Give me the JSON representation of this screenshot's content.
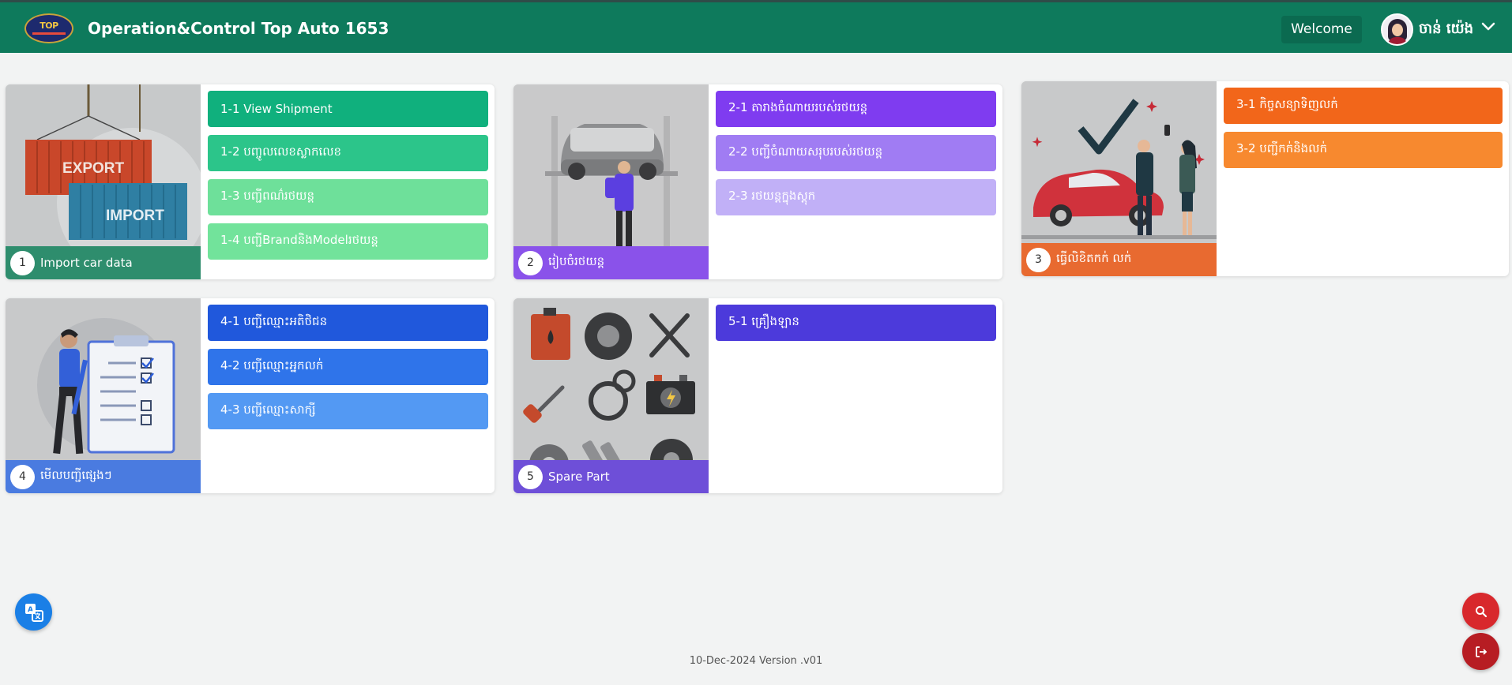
{
  "header": {
    "app_title": "Operation&Control Top Auto 1653",
    "logo_text": "TOP",
    "welcome_label": "Welcome",
    "user_name": "ចាន់ យ៉េង"
  },
  "cards": [
    {
      "number": "1",
      "label": "Import car data",
      "image_icon": "export-import-containers-illustration",
      "caption_color": "#2e8d6d",
      "items": [
        {
          "label": "1-1 View Shipment",
          "color": "#10b07d"
        },
        {
          "label": "1-2 បញ្ចូលលេខស្លាកលេខ",
          "color": "#2cc58a"
        },
        {
          "label": "1-3 បញ្ជីពណ៌រថយន្ត",
          "color": "#6ee09a"
        },
        {
          "label": "1-4 បញ្ជីBrandនិងModelរថយន្ត",
          "color": "#72e39b"
        }
      ]
    },
    {
      "number": "2",
      "label": "រៀបចំរថយន្ត",
      "image_icon": "car-on-lift-mechanic-illustration",
      "caption_color": "#8a52ea",
      "items": [
        {
          "label": "2-1 តារាងចំណាយរបស់រថយន្ត",
          "color": "#7f3cf0"
        },
        {
          "label": "2-2 បញ្ជីចំណាយសរុបរបស់រថយន្ត",
          "color": "#a07cf3"
        },
        {
          "label": "2-3 រថយន្តក្នុងស្តុក",
          "color": "#c1b0f7"
        }
      ]
    },
    {
      "number": "3",
      "label": "ធ្វើលិខិតកក់ លក់",
      "image_icon": "car-sale-handshake-illustration",
      "caption_color": "#e86a30",
      "items": [
        {
          "label": "3-1 កិច្ចសន្យាទិញលក់",
          "color": "#f2661a"
        },
        {
          "label": "3-2 បញ្ជីកក់និងលក់",
          "color": "#f7892f"
        }
      ]
    },
    {
      "number": "4",
      "label": "មើលបញ្ជីផ្សេងៗ",
      "image_icon": "checklist-clipboard-illustration",
      "caption_color": "#4a7be0",
      "items": [
        {
          "label": "4-1 បញ្ជីឈ្មោះអតិថិជន",
          "color": "#2058dc"
        },
        {
          "label": "4-2 បញ្ជីឈ្មោះអ្នកលក់",
          "color": "#2f74ea"
        },
        {
          "label": "4-3 បញ្ជីឈ្មោះសាក្សី",
          "color": "#5399f3"
        }
      ]
    },
    {
      "number": "5",
      "label": "Spare Part",
      "image_icon": "car-spare-parts-illustration",
      "caption_color": "#6e4fd8",
      "items": [
        {
          "label": "5-1 គ្រឿងឡាន",
          "color": "#4c3adb"
        }
      ]
    }
  ],
  "fabs": {
    "translate_icon": "translate-icon",
    "search_icon": "search-icon",
    "logout_icon": "logout-icon",
    "translate_color": "#1a7fe6",
    "search_color": "#d8282c",
    "logout_color": "#b71d23"
  },
  "footer": {
    "version_text": "10-Dec-2024 Version .v01"
  }
}
